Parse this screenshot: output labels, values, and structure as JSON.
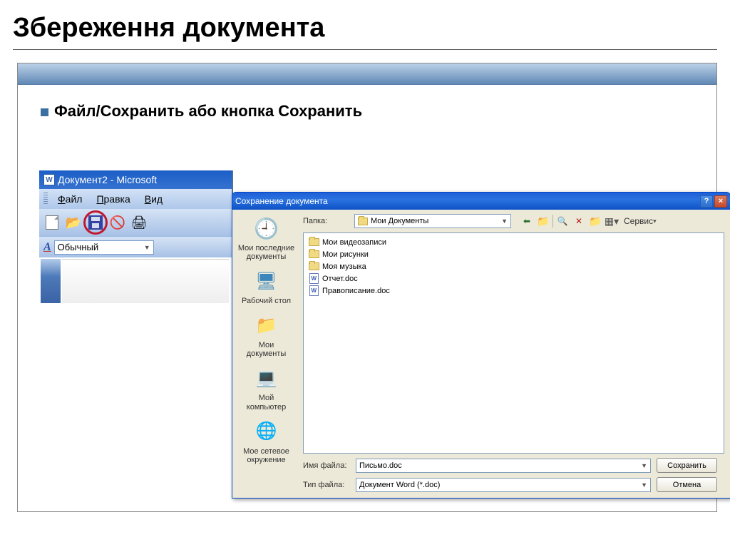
{
  "slide": {
    "title": "Збереження документа",
    "bullet": "Файл/Сохранить  або кнопка Сохранить"
  },
  "word": {
    "title": "Документ2 - Microsoft",
    "menus": {
      "file": "Файл",
      "edit": "Правка",
      "view": "Вид"
    },
    "style_combo": "Обычный"
  },
  "dialog": {
    "title": "Сохранение документа",
    "lookin_label": "Папка:",
    "lookin_value": "Мои Документы",
    "service_label": "Сервис",
    "places": [
      {
        "label": "Мои последние документы"
      },
      {
        "label": "Рабочий стол"
      },
      {
        "label": "Мои документы"
      },
      {
        "label": "Мой компьютер"
      },
      {
        "label": "Мое сетевое окружение"
      }
    ],
    "files": [
      {
        "type": "folder",
        "name": "Мои видеозаписи"
      },
      {
        "type": "folder",
        "name": "Мои рисунки"
      },
      {
        "type": "folder",
        "name": "Моя музыка"
      },
      {
        "type": "doc",
        "name": "Отчет.doc"
      },
      {
        "type": "doc",
        "name": "Правописание.doc"
      }
    ],
    "filename_label": "Имя файла:",
    "filename_value": "Письмо.doc",
    "filetype_label": "Тип файла:",
    "filetype_value": "Документ Word (*.doc)",
    "save_btn": "Сохранить",
    "cancel_btn": "Отмена"
  }
}
